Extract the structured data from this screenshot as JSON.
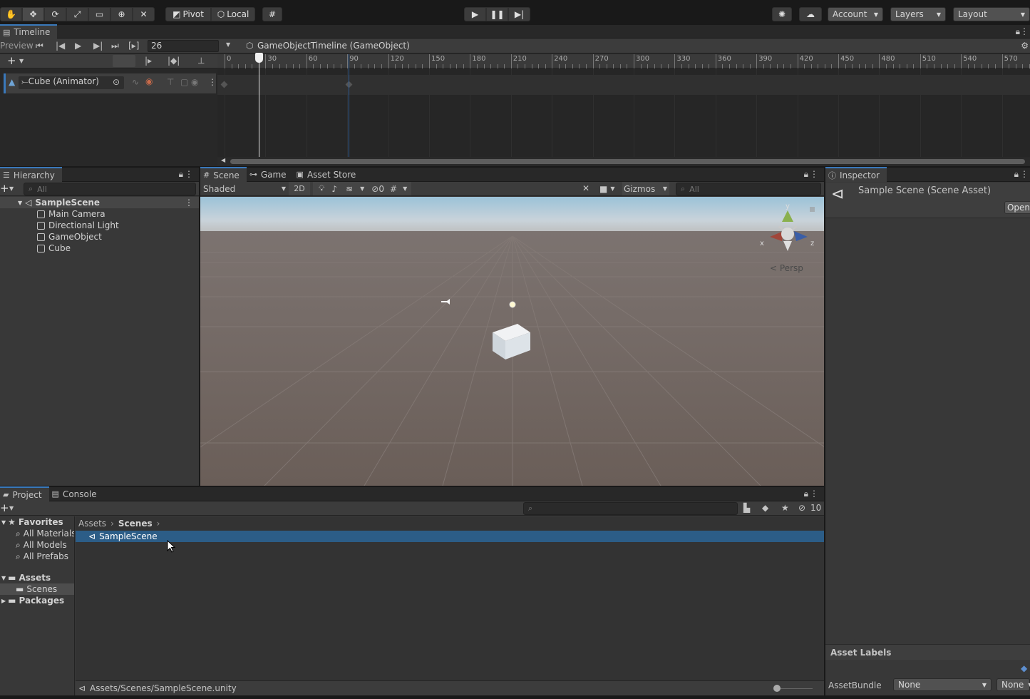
{
  "toolbar": {
    "pivot": "Pivot",
    "local": "Local",
    "account": "Account",
    "layers": "Layers",
    "layout": "Layout"
  },
  "timeline": {
    "tab": "Timeline",
    "preview": "Preview",
    "frame": "26",
    "asset_title": "GameObjectTimeline (GameObject)",
    "ruler": [
      "0",
      "30",
      "60",
      "90",
      "120",
      "150",
      "180",
      "210",
      "240",
      "270",
      "300",
      "330",
      "360",
      "390",
      "420",
      "450",
      "480",
      "510",
      "540",
      "570"
    ],
    "track_label": "Cube (Animator)"
  },
  "hierarchy": {
    "tab": "Hierarchy",
    "search_placeholder": "All",
    "scene": "SampleScene",
    "items": [
      "Main Camera",
      "Directional Light",
      "GameObject",
      "Cube"
    ]
  },
  "scene_view": {
    "tabs": [
      "Scene",
      "Game",
      "Asset Store"
    ],
    "shading": "Shaded",
    "mode_2d": "2D",
    "hidden_count": "0",
    "gizmos": "Gizmos",
    "search_placeholder": "All",
    "persp": "Persp",
    "axis_x": "x",
    "axis_y": "y",
    "axis_z": "z"
  },
  "inspector": {
    "tab": "Inspector",
    "title": "Sample Scene (Scene Asset)",
    "open_button": "Open",
    "asset_labels": "Asset Labels",
    "assetbundle_label": "AssetBundle",
    "assetbundle_value": "None",
    "variant_value": "None"
  },
  "project": {
    "tabs": [
      "Project",
      "Console"
    ],
    "hidden_count": "10",
    "favorites_header": "Favorites",
    "favorites": [
      "All Materials",
      "All Models",
      "All Prefabs"
    ],
    "assets_header": "Assets",
    "assets_children": [
      "Scenes"
    ],
    "packages": "Packages",
    "breadcrumb": [
      "Assets",
      "Scenes"
    ],
    "files": [
      "SampleScene"
    ],
    "status_path": "Assets/Scenes/SampleScene.unity"
  }
}
